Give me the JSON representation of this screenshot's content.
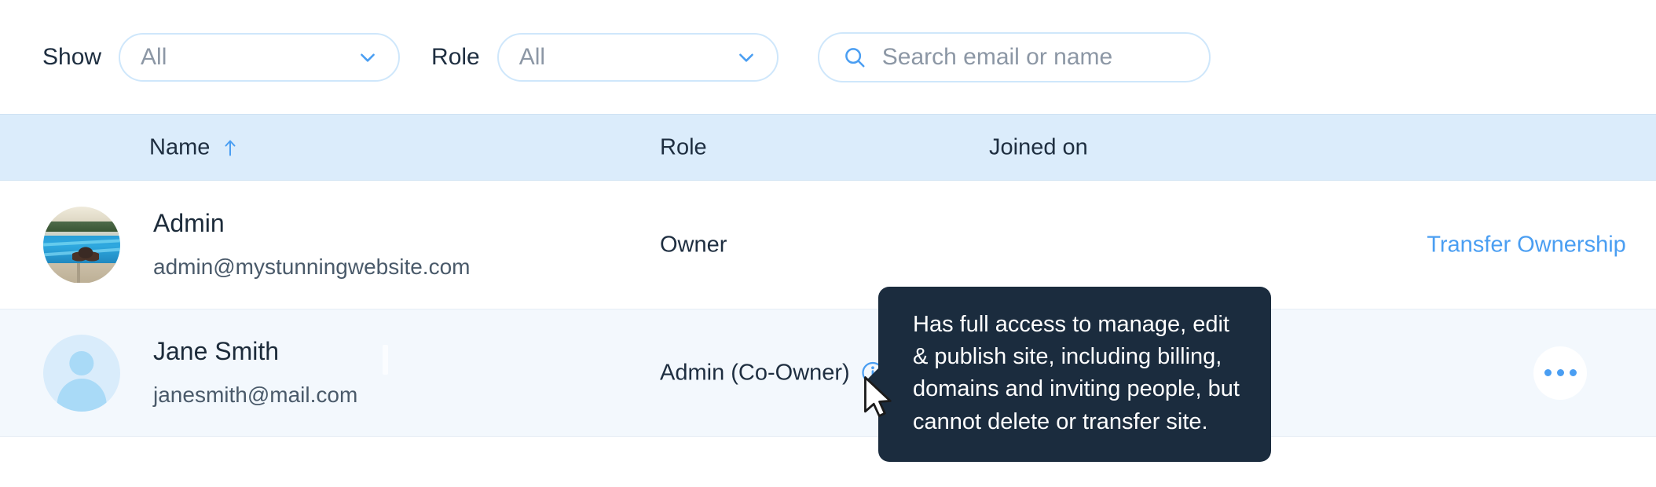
{
  "filters": {
    "show_label": "Show",
    "show_value": "All",
    "role_label": "Role",
    "role_value": "All",
    "search_placeholder": "Search email or name",
    "search_value": "",
    "chevron_icon": "chevron-down-icon",
    "search_icon": "search-icon",
    "accent_color": "#4a9ef2",
    "border_color": "#cfe7fb"
  },
  "table": {
    "header_bg": "#dbecfb",
    "columns": [
      {
        "key": "name",
        "label": "Name",
        "sorted": true,
        "sort_direction": "asc",
        "sort_icon": "sort-arrow-up-icon"
      },
      {
        "key": "role",
        "label": "Role",
        "sorted": false
      },
      {
        "key": "joined_on",
        "label": "Joined on",
        "sorted": false
      }
    ],
    "rows": [
      {
        "name": "Admin",
        "email": "admin@mystunningwebsite.com",
        "role": "Owner",
        "has_info_icon": false,
        "joined_on": "",
        "action_label": "Transfer Ownership",
        "action_type": "link",
        "avatar_type": "photo",
        "row_bg": "#ffffff"
      },
      {
        "name": "Jane Smith",
        "email": "janesmith@mail.com",
        "role": "Admin (Co-Owner)",
        "has_info_icon": true,
        "info_icon": "info-circle-icon",
        "joined_on": "",
        "action_label": "",
        "action_type": "more-menu",
        "more_icon": "ellipsis-horizontal-icon",
        "avatar_type": "default-person",
        "row_bg": "#f3f8fd"
      }
    ]
  },
  "tooltip": {
    "text": "Has full access to manage, edit & publish site, including billing, domains and inviting people, but cannot delete or transfer site.",
    "bg_color": "#1b2c3e",
    "text_color": "#ffffff"
  },
  "cursor": {
    "icon": "mouse-pointer-icon"
  }
}
